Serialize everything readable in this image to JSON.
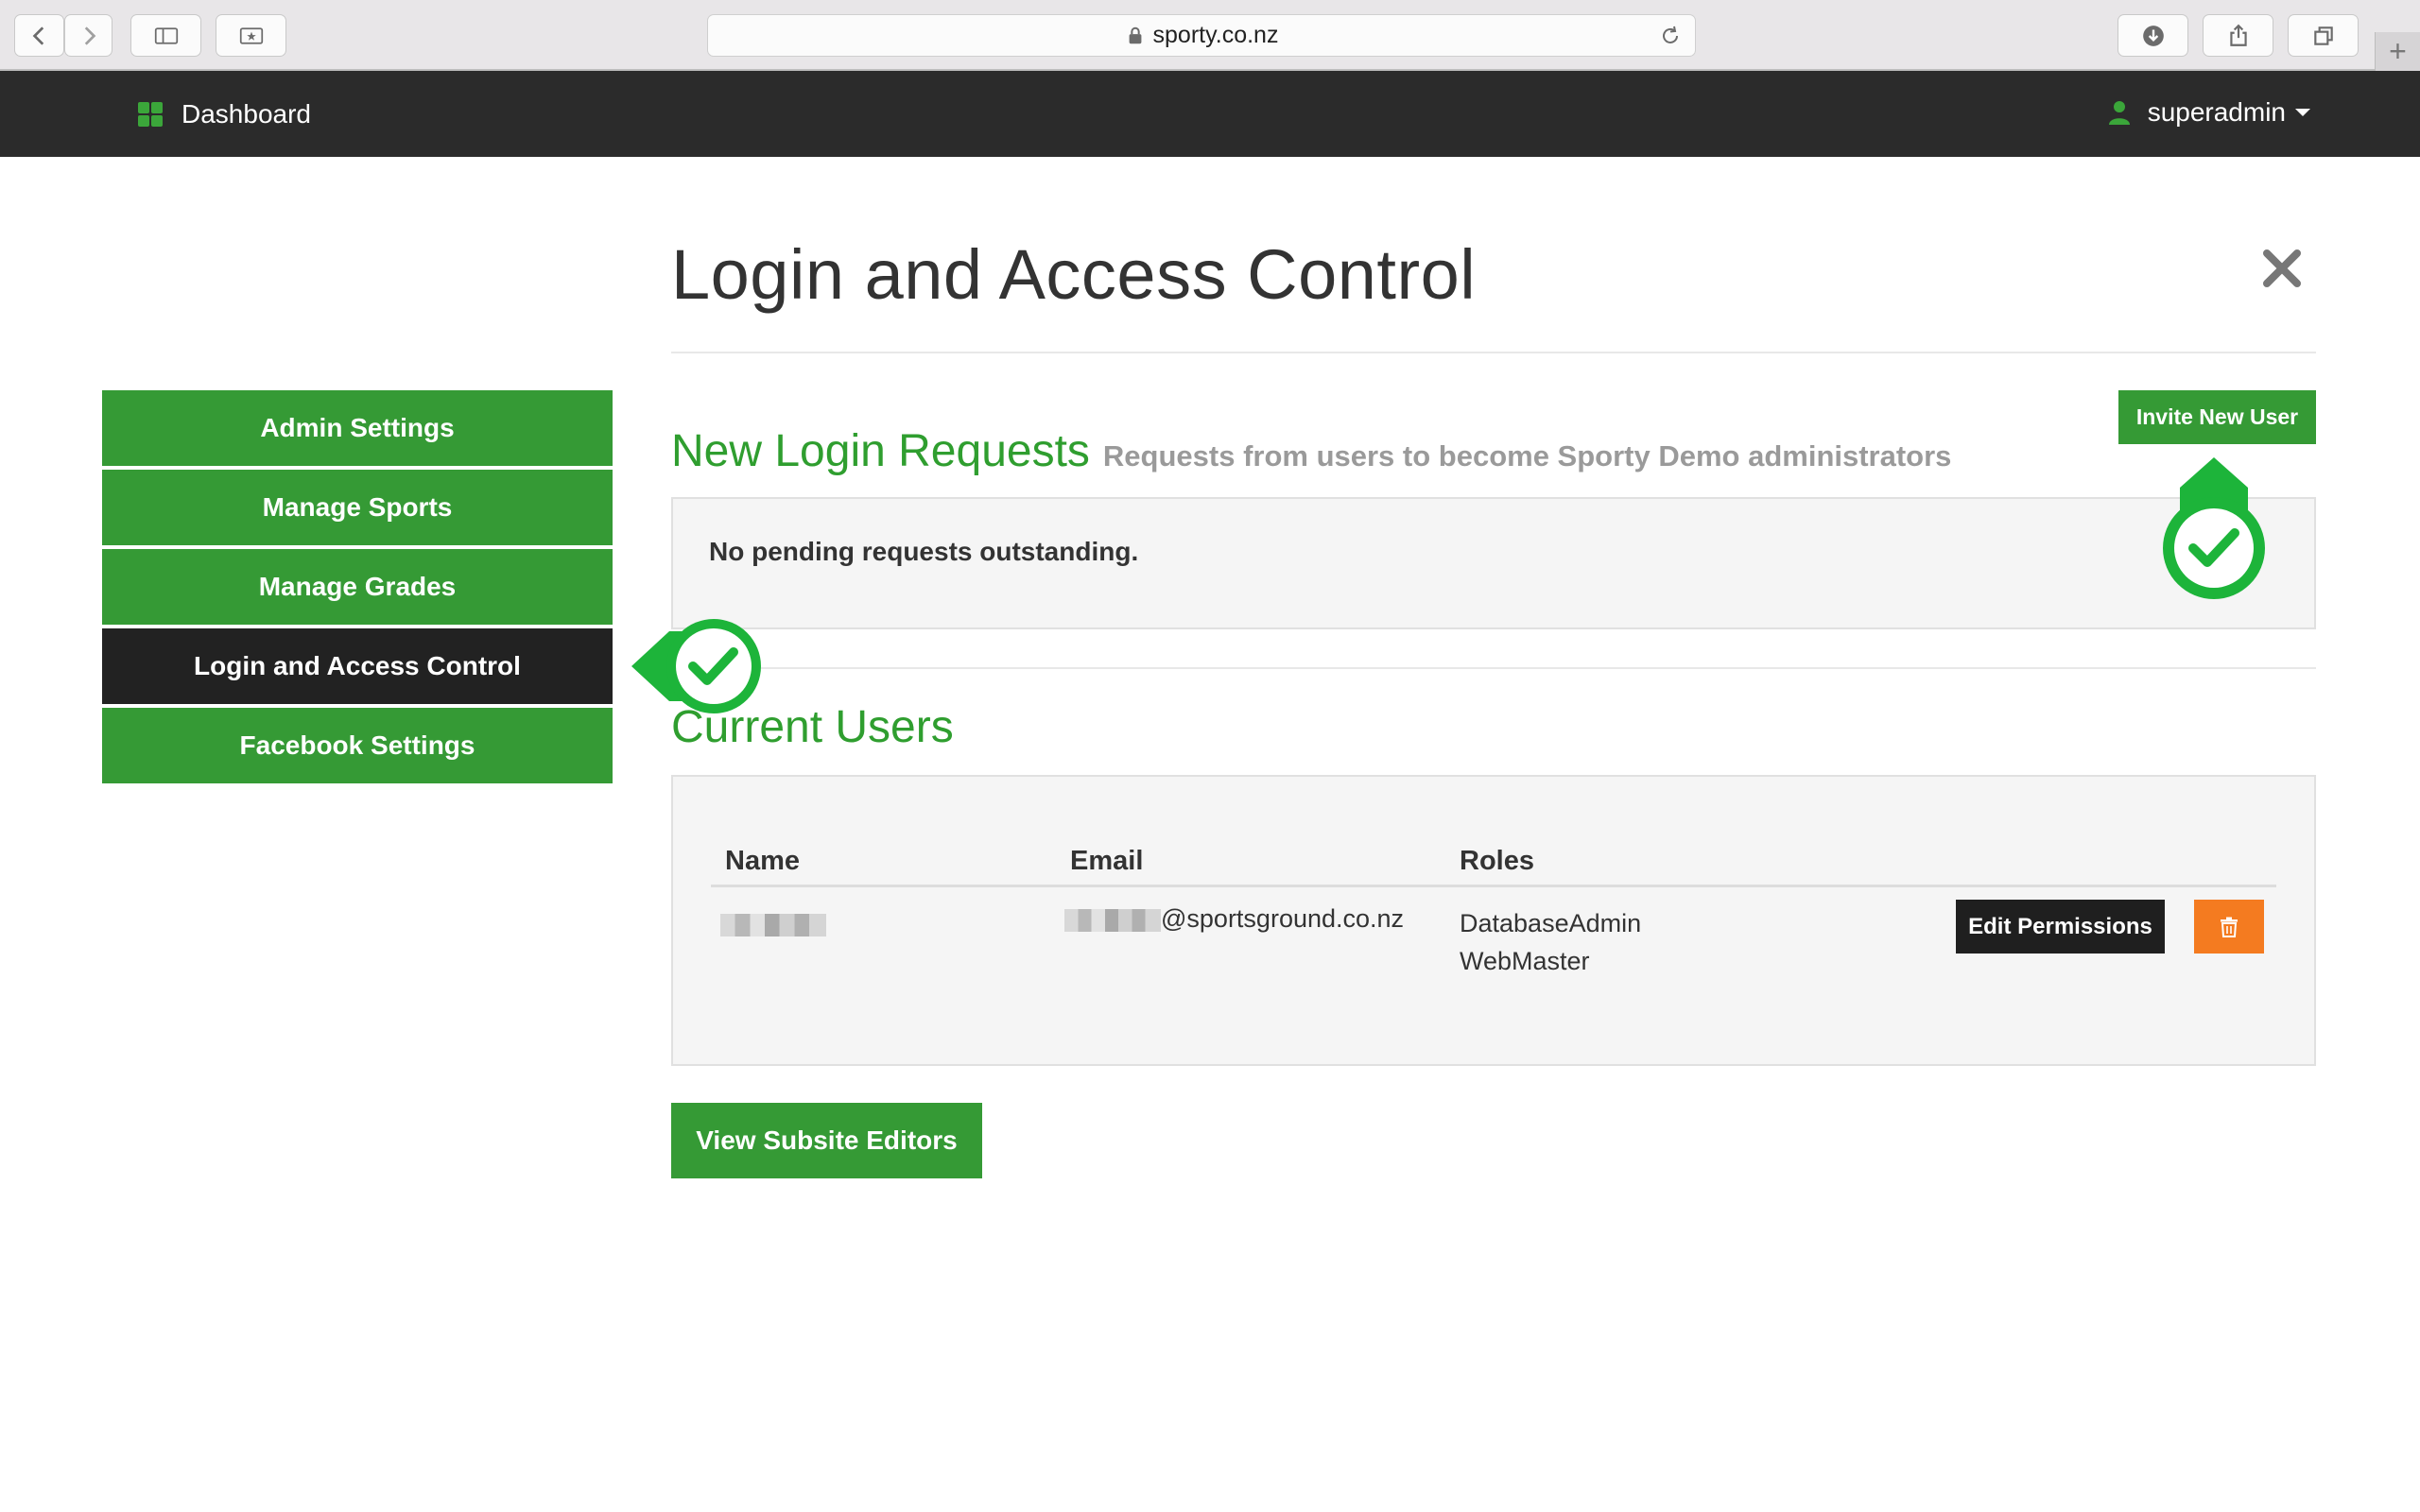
{
  "browser": {
    "url": "sporty.co.nz"
  },
  "topnav": {
    "dashboard_label": "Dashboard",
    "user_label": "superadmin"
  },
  "sidebar": {
    "items": [
      {
        "label": "Admin Settings"
      },
      {
        "label": "Manage Sports"
      },
      {
        "label": "Manage Grades"
      },
      {
        "label": "Login and Access Control"
      },
      {
        "label": "Facebook Settings"
      }
    ]
  },
  "main": {
    "page_title": "Login and Access Control",
    "invite_button": "Invite New User",
    "new_requests": {
      "title": "New Login Requests",
      "subtitle": "Requests from users to become Sporty Demo administrators",
      "empty_message": "No pending requests outstanding."
    },
    "current_users": {
      "title": "Current Users",
      "columns": [
        "Name",
        "Email",
        "Roles"
      ],
      "rows": [
        {
          "email_domain": "@sportsground.co.nz",
          "roles": [
            "DatabaseAdmin",
            "WebMaster"
          ],
          "edit_label": "Edit Permissions"
        }
      ]
    },
    "view_subsite_button": "View Subsite Editors"
  },
  "colors": {
    "brand_green": "#359a35",
    "title_green": "#2f9e2f",
    "marker_green": "#1db43a",
    "nav_dark": "#2b2b2b",
    "delete_orange": "#f47b20"
  }
}
